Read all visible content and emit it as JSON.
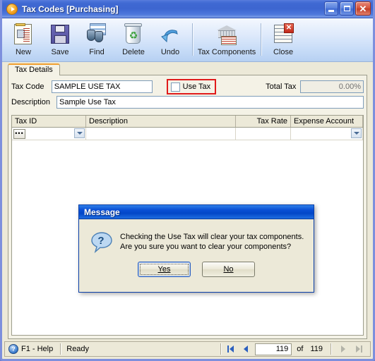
{
  "window": {
    "title": "Tax Codes [Purchasing]",
    "title_icon": "play-circle-icon",
    "minimize_label": "",
    "maximize_label": "",
    "close_label": "✕"
  },
  "toolbar": {
    "items": [
      {
        "label": "New",
        "icon": "new-document-icon"
      },
      {
        "label": "Save",
        "icon": "floppy-disk-icon"
      },
      {
        "label": "Find",
        "icon": "binoculars-icon"
      },
      {
        "label": "Delete",
        "icon": "recycle-bin-icon"
      },
      {
        "label": "Undo",
        "icon": "undo-arrow-icon"
      },
      {
        "label": "Tax Components",
        "icon": "bank-building-icon"
      },
      {
        "label": "Close",
        "icon": "close-document-icon"
      }
    ]
  },
  "tabs": [
    {
      "label": "Tax Details",
      "active": true
    }
  ],
  "form": {
    "tax_code_label": "Tax Code",
    "tax_code_value": "SAMPLE USE TAX",
    "use_tax_label": "Use Tax",
    "use_tax_checked": false,
    "total_tax_label": "Total Tax",
    "total_tax_value": "0.00%",
    "description_label": "Description",
    "description_value": "Sample Use Tax"
  },
  "grid": {
    "columns": [
      {
        "label": "Tax ID",
        "align": "left"
      },
      {
        "label": "Description",
        "align": "left"
      },
      {
        "label": "Tax Rate",
        "align": "right"
      },
      {
        "label": "Expense Account",
        "align": "left"
      }
    ],
    "rows": [
      {
        "tax_id": "",
        "description": "",
        "tax_rate": "",
        "expense_account": ""
      }
    ],
    "ellipsis_label": "•••"
  },
  "dialog": {
    "title": "Message",
    "icon": "question-bubble-icon",
    "message_line1": "Checking the Use Tax will clear your tax components.",
    "message_line2": "Are you sure you want to clear your components?",
    "buttons": [
      {
        "label": "Yes",
        "mnemonic": "Y",
        "focused": true
      },
      {
        "label": "No",
        "mnemonic": "N",
        "focused": false
      }
    ]
  },
  "statusbar": {
    "help_label": "F1 - Help",
    "help_icon": "question-circle-icon",
    "status_text": "Ready",
    "record_current": "119",
    "of_label": "of",
    "record_total": "119",
    "first_icon": "first-record-icon",
    "prev_icon": "previous-record-icon",
    "next_icon": "next-record-icon",
    "last_icon": "last-record-icon"
  },
  "colors": {
    "title_blue": "#3d66d0",
    "dialog_blue": "#0246c8",
    "tab_accent": "#f0a030",
    "highlight_red": "#e01b1b",
    "window_face": "#ece9d8"
  }
}
